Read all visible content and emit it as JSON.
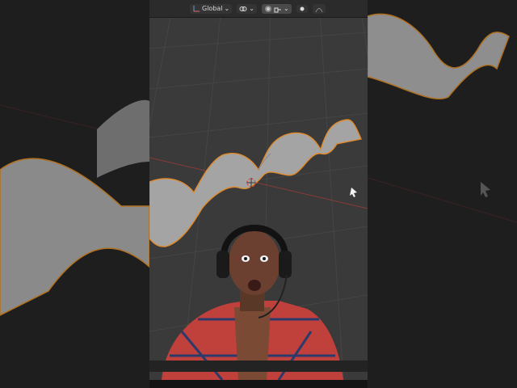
{
  "header": {
    "transform_orientation": "Global",
    "chevron_glyph": "⌄"
  },
  "icons": [
    "transform-orientation-icon",
    "snap-link-icon",
    "proportional-edit-icon",
    "snap-target-icon",
    "overlay-dot-icon",
    "curve-icon",
    "mouse-cursor-icon",
    "3d-cursor-icon"
  ],
  "colors": {
    "viewport_bg": "#3a3a3a",
    "grid_line": "#454545",
    "x_axis": "#8a3a3a",
    "surface": "#9c9c9c",
    "selection_outline": "#e08a2a"
  },
  "overlay": {
    "webcam": "person-wearing-headset-plaid-shirt"
  }
}
